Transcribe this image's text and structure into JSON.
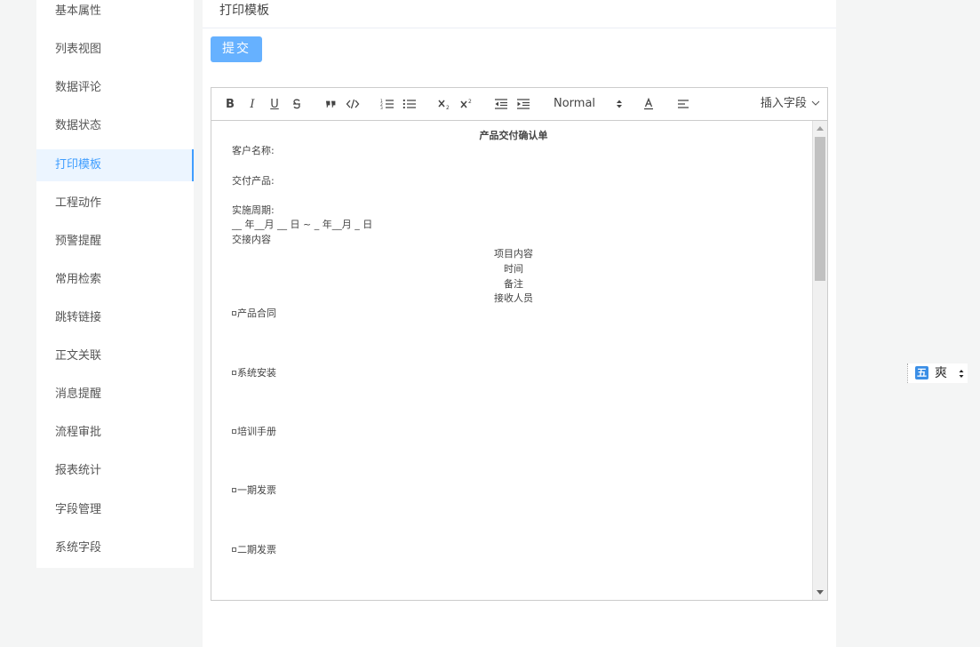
{
  "sidebar": {
    "items": [
      {
        "label": "基本属性"
      },
      {
        "label": "列表视图"
      },
      {
        "label": "数据评论"
      },
      {
        "label": "数据状态"
      },
      {
        "label": "打印模板",
        "active": true
      },
      {
        "label": "工程动作"
      },
      {
        "label": "预警提醒"
      },
      {
        "label": "常用检索"
      },
      {
        "label": "跳转链接"
      },
      {
        "label": "正文关联"
      },
      {
        "label": "消息提醒"
      },
      {
        "label": "流程审批"
      },
      {
        "label": "报表统计"
      },
      {
        "label": "字段管理"
      },
      {
        "label": "系统字段"
      }
    ]
  },
  "main": {
    "header_title": "打印模板",
    "submit_label": "提交"
  },
  "toolbar": {
    "bold": "B",
    "italic": "I",
    "underline": "U",
    "header_select": "Normal",
    "insert_field": "插入字段"
  },
  "document": {
    "title": "产品交付确认单",
    "customer_label": "客户名称:",
    "product_label": "交付产品:",
    "period_label": "实施周期:",
    "period_value": "__ 年__月 __ 日 ~ _ 年__月 _ 日",
    "handover_label": "交接内容",
    "table_headers": [
      "项目内容",
      "时间",
      "备注",
      "接收人员"
    ],
    "items": [
      "产品合同",
      "系统安装",
      "培训手册",
      "一期发票",
      "二期发票"
    ]
  },
  "ime": {
    "badge": "五",
    "mode": "爽"
  },
  "colors": {
    "accent": "#409eff",
    "button": "#66b1ff",
    "background": "#f4f5f5"
  }
}
